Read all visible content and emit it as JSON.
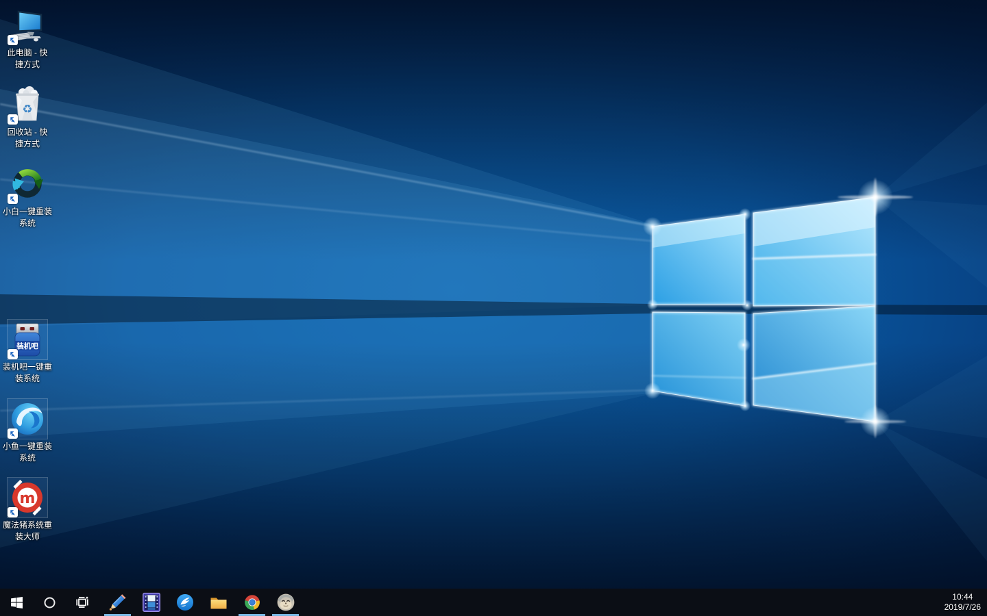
{
  "wallpaper": {
    "base_color": "#0a57a0",
    "dark_color": "#021638",
    "logo_pane_color": "#57c2f5"
  },
  "desktop": {
    "recycle_glyph": "♻",
    "icons": [
      {
        "id": "this-pc-shortcut",
        "label": "此电脑 - 快\n捷方式"
      },
      {
        "id": "recycle-bin-shortcut",
        "label": "回收站 - 快\n捷方式"
      },
      {
        "id": "xiaobai-reinstall",
        "label": "小白一键重装\n系统"
      },
      {
        "id": "zhuangjiba-reinstall",
        "label": "装机吧一键重\n装系统",
        "icon_text": "装机吧"
      },
      {
        "id": "xiaoyu-reinstall",
        "label": "小鱼一键重装\n系统"
      },
      {
        "id": "mofazhu-reinstall",
        "label": "魔法猪系统重\n装大师",
        "icon_text": "m"
      }
    ]
  },
  "taskbar": {
    "background": "#0b0e15",
    "underline_color": "#79b7e3",
    "items": [
      {
        "name": "start",
        "running": false
      },
      {
        "name": "search",
        "running": false
      },
      {
        "name": "task-view",
        "running": false
      },
      {
        "name": "pencil-app",
        "running": true
      },
      {
        "name": "video-app",
        "running": false
      },
      {
        "name": "wing-app",
        "running": false
      },
      {
        "name": "file-explorer",
        "running": false
      },
      {
        "name": "chrome",
        "running": true
      },
      {
        "name": "avatar-app",
        "running": true
      }
    ]
  },
  "tray": {
    "time": "10:44",
    "date": "2019/7/26"
  }
}
